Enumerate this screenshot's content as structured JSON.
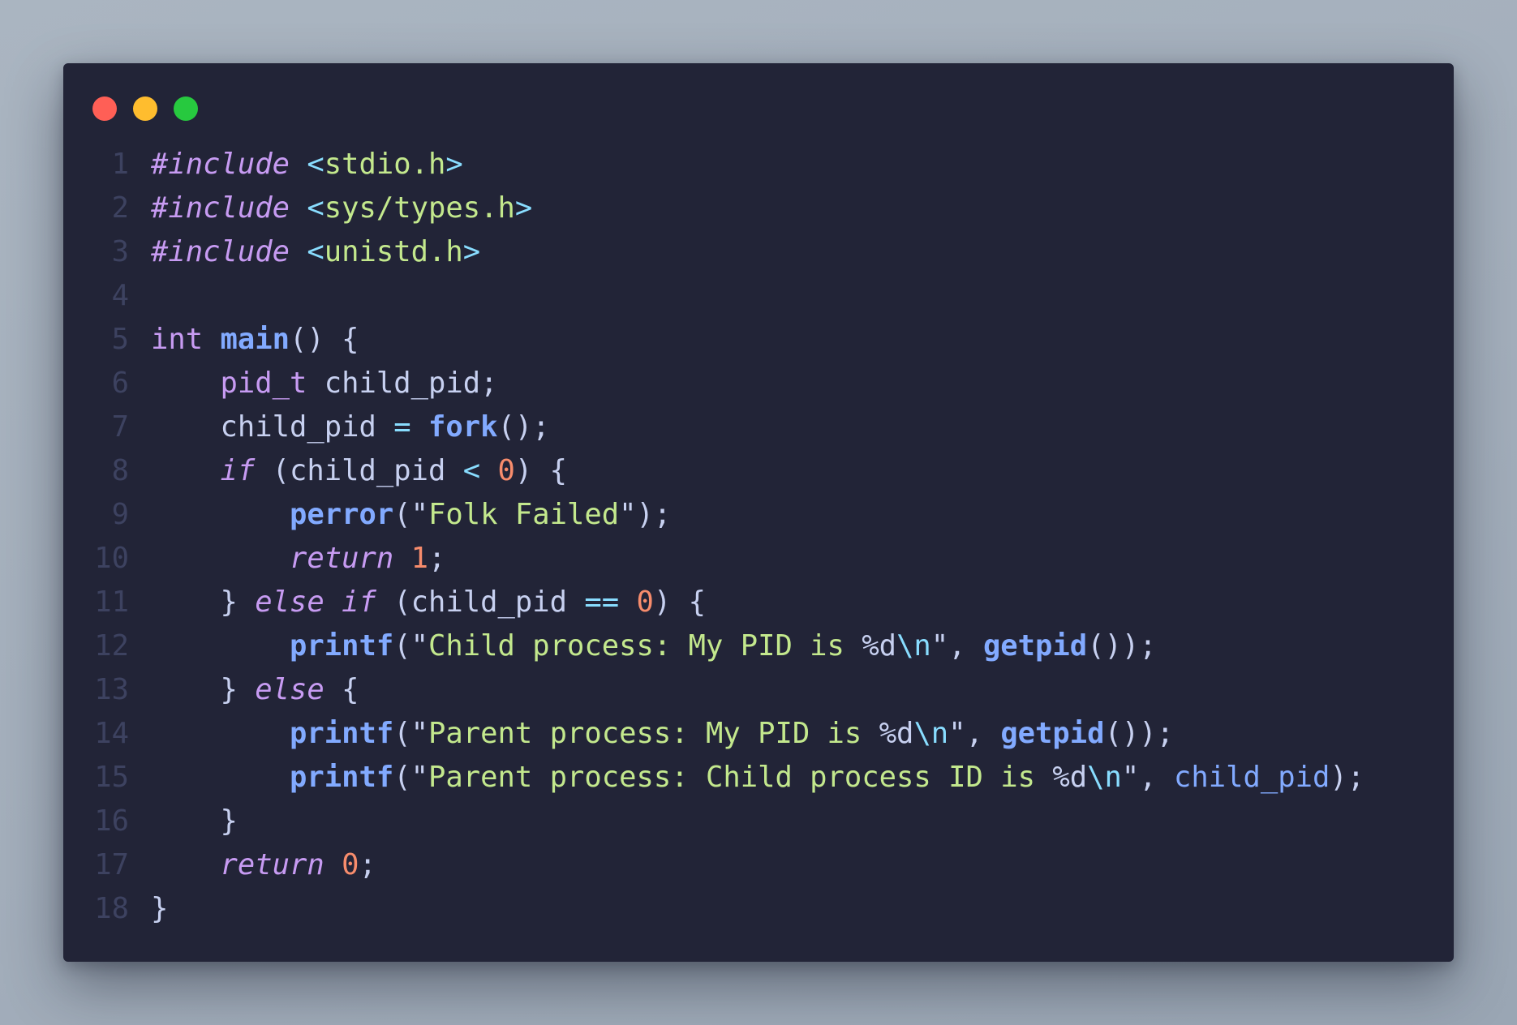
{
  "window": {
    "controls": [
      "close",
      "minimize",
      "maximize"
    ],
    "colors": {
      "background": "#222437",
      "close": "#ff5f56",
      "minimize": "#ffbd2e",
      "maximize": "#27c93f"
    }
  },
  "editor": {
    "language": "C",
    "lines": [
      {
        "number": "1",
        "tokens": [
          {
            "t": "#include",
            "c": "kw-pp"
          },
          {
            "t": " ",
            "c": "var"
          },
          {
            "t": "<",
            "c": "punc"
          },
          {
            "t": "stdio.h",
            "c": "inc"
          },
          {
            "t": ">",
            "c": "punc"
          }
        ]
      },
      {
        "number": "2",
        "tokens": [
          {
            "t": "#include",
            "c": "kw-pp"
          },
          {
            "t": " ",
            "c": "var"
          },
          {
            "t": "<",
            "c": "punc"
          },
          {
            "t": "sys/types.h",
            "c": "inc"
          },
          {
            "t": ">",
            "c": "punc"
          }
        ]
      },
      {
        "number": "3",
        "tokens": [
          {
            "t": "#include",
            "c": "kw-pp"
          },
          {
            "t": " ",
            "c": "var"
          },
          {
            "t": "<",
            "c": "punc"
          },
          {
            "t": "unistd.h",
            "c": "inc"
          },
          {
            "t": ">",
            "c": "punc"
          }
        ]
      },
      {
        "number": "4",
        "tokens": []
      },
      {
        "number": "5",
        "tokens": [
          {
            "t": "int",
            "c": "kw"
          },
          {
            "t": " ",
            "c": "var"
          },
          {
            "t": "main",
            "c": "fn"
          },
          {
            "t": "() {",
            "c": "brace"
          }
        ]
      },
      {
        "number": "6",
        "tokens": [
          {
            "t": "    ",
            "c": "var"
          },
          {
            "t": "pid_t",
            "c": "kw"
          },
          {
            "t": " child_pid;",
            "c": "var"
          }
        ]
      },
      {
        "number": "7",
        "tokens": [
          {
            "t": "    child_pid ",
            "c": "var"
          },
          {
            "t": "=",
            "c": "punc"
          },
          {
            "t": " ",
            "c": "var"
          },
          {
            "t": "fork",
            "c": "fn"
          },
          {
            "t": "();",
            "c": "brace"
          }
        ]
      },
      {
        "number": "8",
        "tokens": [
          {
            "t": "    ",
            "c": "var"
          },
          {
            "t": "if",
            "c": "kw-it"
          },
          {
            "t": " (child_pid ",
            "c": "var"
          },
          {
            "t": "<",
            "c": "punc"
          },
          {
            "t": " ",
            "c": "var"
          },
          {
            "t": "0",
            "c": "num"
          },
          {
            "t": ") {",
            "c": "brace"
          }
        ]
      },
      {
        "number": "9",
        "tokens": [
          {
            "t": "        ",
            "c": "var"
          },
          {
            "t": "perror",
            "c": "fn"
          },
          {
            "t": "(\"",
            "c": "brace"
          },
          {
            "t": "Folk Failed",
            "c": "str"
          },
          {
            "t": "\");",
            "c": "brace"
          }
        ]
      },
      {
        "number": "10",
        "tokens": [
          {
            "t": "        ",
            "c": "var"
          },
          {
            "t": "return",
            "c": "kw-it"
          },
          {
            "t": " ",
            "c": "var"
          },
          {
            "t": "1",
            "c": "num"
          },
          {
            "t": ";",
            "c": "brace"
          }
        ]
      },
      {
        "number": "11",
        "tokens": [
          {
            "t": "    } ",
            "c": "brace"
          },
          {
            "t": "else",
            "c": "kw-it"
          },
          {
            "t": " ",
            "c": "var"
          },
          {
            "t": "if",
            "c": "kw-it"
          },
          {
            "t": " (child_pid ",
            "c": "var"
          },
          {
            "t": "==",
            "c": "punc"
          },
          {
            "t": " ",
            "c": "var"
          },
          {
            "t": "0",
            "c": "num"
          },
          {
            "t": ") {",
            "c": "brace"
          }
        ]
      },
      {
        "number": "12",
        "tokens": [
          {
            "t": "        ",
            "c": "var"
          },
          {
            "t": "printf",
            "c": "fn"
          },
          {
            "t": "(\"",
            "c": "brace"
          },
          {
            "t": "Child process: My PID is ",
            "c": "str"
          },
          {
            "t": "%d",
            "c": "fmt"
          },
          {
            "t": "\\n",
            "c": "esc"
          },
          {
            "t": "\", ",
            "c": "brace"
          },
          {
            "t": "getpid",
            "c": "fn"
          },
          {
            "t": "());",
            "c": "brace"
          }
        ]
      },
      {
        "number": "13",
        "tokens": [
          {
            "t": "    } ",
            "c": "brace"
          },
          {
            "t": "else",
            "c": "kw-it"
          },
          {
            "t": " {",
            "c": "brace"
          }
        ]
      },
      {
        "number": "14",
        "tokens": [
          {
            "t": "        ",
            "c": "var"
          },
          {
            "t": "printf",
            "c": "fn"
          },
          {
            "t": "(\"",
            "c": "brace"
          },
          {
            "t": "Parent process: My PID is ",
            "c": "str"
          },
          {
            "t": "%d",
            "c": "fmt"
          },
          {
            "t": "\\n",
            "c": "esc"
          },
          {
            "t": "\", ",
            "c": "brace"
          },
          {
            "t": "getpid",
            "c": "fn"
          },
          {
            "t": "());",
            "c": "brace"
          }
        ]
      },
      {
        "number": "15",
        "tokens": [
          {
            "t": "        ",
            "c": "var"
          },
          {
            "t": "printf",
            "c": "fn"
          },
          {
            "t": "(\"",
            "c": "brace"
          },
          {
            "t": "Parent process: Child process ID is ",
            "c": "str"
          },
          {
            "t": "%d",
            "c": "fmt"
          },
          {
            "t": "\\n",
            "c": "esc"
          },
          {
            "t": "\", ",
            "c": "brace"
          },
          {
            "t": "child_pid",
            "c": "param"
          },
          {
            "t": ");",
            "c": "brace"
          }
        ]
      },
      {
        "number": "16",
        "tokens": [
          {
            "t": "    }",
            "c": "brace"
          }
        ]
      },
      {
        "number": "17",
        "tokens": [
          {
            "t": "    ",
            "c": "var"
          },
          {
            "t": "return",
            "c": "kw-it"
          },
          {
            "t": " ",
            "c": "var"
          },
          {
            "t": "0",
            "c": "num"
          },
          {
            "t": ";",
            "c": "brace"
          }
        ]
      },
      {
        "number": "18",
        "tokens": [
          {
            "t": "}",
            "c": "brace"
          }
        ]
      }
    ]
  }
}
